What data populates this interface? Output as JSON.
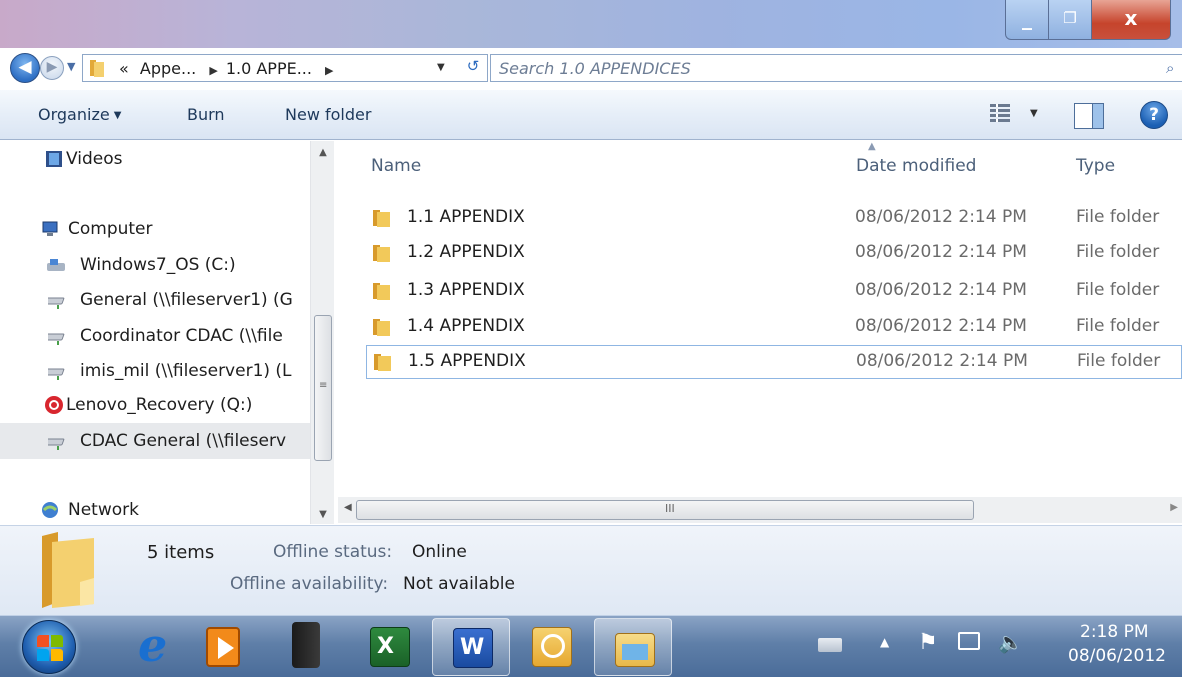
{
  "window": {
    "controls": {
      "minimize": "_",
      "maximize": "❐",
      "close": "x"
    }
  },
  "address": {
    "prefix": "«",
    "crumbs": [
      "Appe...",
      "1.0 APPE..."
    ],
    "search_placeholder": "Search 1.0 APPENDICES"
  },
  "toolbar": {
    "organize": "Organize",
    "burn": "Burn",
    "new_folder": "New folder"
  },
  "nav": {
    "items": [
      {
        "label": "Videos",
        "icon": "videos-icon"
      },
      {
        "label": "Computer",
        "icon": "computer-icon"
      },
      {
        "label": "Windows7_OS (C:)",
        "icon": "drive-icon"
      },
      {
        "label": "General (\\\\fileserver1) (G",
        "icon": "network-drive-icon"
      },
      {
        "label": "Coordinator CDAC (\\\\file",
        "icon": "network-drive-icon"
      },
      {
        "label": "imis_mil (\\\\fileserver1) (L",
        "icon": "network-drive-icon"
      },
      {
        "label": "Lenovo_Recovery (Q:)",
        "icon": "recovery-drive-icon"
      },
      {
        "label": "CDAC General (\\\\fileserv",
        "icon": "network-drive-icon",
        "selected": true
      },
      {
        "label": "Network",
        "icon": "network-icon"
      }
    ]
  },
  "columns": {
    "name": "Name",
    "date": "Date modified",
    "type": "Type"
  },
  "files": [
    {
      "name": "1.1 APPENDIX",
      "date": "08/06/2012 2:14 PM",
      "type": "File folder"
    },
    {
      "name": "1.2 APPENDIX",
      "date": "08/06/2012 2:14 PM",
      "type": "File folder"
    },
    {
      "name": "1.3 APPENDIX",
      "date": "08/06/2012 2:14 PM",
      "type": "File folder"
    },
    {
      "name": "1.4 APPENDIX",
      "date": "08/06/2012 2:14 PM",
      "type": "File folder"
    },
    {
      "name": "1.5 APPENDIX",
      "date": "08/06/2012 2:14 PM",
      "type": "File folder",
      "selected": true
    }
  ],
  "details": {
    "count": "5 items",
    "status_key": "Offline status:",
    "status_val": "Online",
    "avail_key": "Offline availability:",
    "avail_val": "Not available"
  },
  "taskbar": {
    "apps": [
      "internet-explorer-icon",
      "media-player-icon",
      "server-icon",
      "excel-icon",
      "word-icon",
      "outlook-icon",
      "explorer-icon"
    ],
    "clock_time": "2:18 PM",
    "clock_date": "08/06/2012"
  },
  "colors": {
    "accent": "#1e395b",
    "selection_border": "#8fb6e3",
    "folder": "#f2c95a"
  }
}
